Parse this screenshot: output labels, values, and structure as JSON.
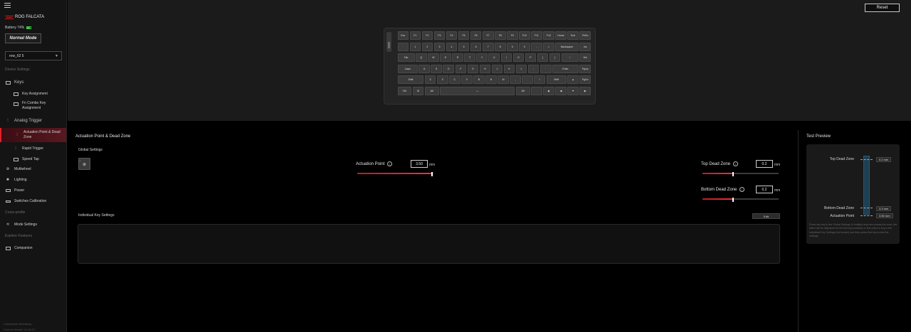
{
  "sidebar": {
    "menu_icon": "hamburger-icon",
    "brand": "ROG FALCATA",
    "battery_label": "Battery 74%",
    "battery_percent": 74,
    "mode_label": "Normal Mode",
    "profile": "row_62 5",
    "device_settings_label": "Device Settings",
    "keys_label": "Keys",
    "key_assignment": "Key Assignment",
    "fn_combo_line1": "Fn Combo Key",
    "fn_combo_line2": "Assignment",
    "analog_trigger_label": "Analog Trigger",
    "actuation_dead_zone_line1": "Actuation Point & Dead",
    "actuation_dead_zone_line2": "Zone",
    "rapid_trigger": "Rapid Trigger",
    "speed_tap": "Speed Tap",
    "multiwheel": "Multiwheel",
    "lighting": "Lighting",
    "power": "Power",
    "switches_calibration": "Switches Calibration",
    "cross_profile_label": "Cross-profile",
    "mode_settings": "Mode Settings",
    "explore_features_label": "Explore Features",
    "companion": "Companion",
    "footer_status": "Companion Activating...",
    "footer_version": "Control Version V1.00.07"
  },
  "toolbar": {
    "reset_label": "Reset"
  },
  "keyboard": {
    "rows": [
      [
        "Esc",
        "F1",
        "F2",
        "F3",
        "F4",
        "F5",
        "F6",
        "F7",
        "F8",
        "F9",
        "F10",
        "F11",
        "F12",
        "Home",
        "End",
        "PrtSc"
      ],
      [
        "`",
        "1",
        "2",
        "3",
        "4",
        "5",
        "6",
        "7",
        "8",
        "9",
        "0",
        "-",
        "=",
        "Backspace",
        "Ins"
      ],
      [
        "Tab",
        "Q",
        "W",
        "E",
        "R",
        "T",
        "Y",
        "U",
        "I",
        "O",
        "P",
        "[",
        "]",
        "\\",
        "Del"
      ],
      [
        "Caps",
        "A",
        "S",
        "D",
        "F",
        "G",
        "H",
        "J",
        "K",
        "L",
        ";",
        "'",
        "Enter",
        "PgUp"
      ],
      [
        "Shift",
        "Z",
        "X",
        "C",
        "V",
        "B",
        "N",
        "M",
        ",",
        ".",
        "/",
        "Shift",
        "▲",
        "PgDn"
      ],
      [
        "Ctrl",
        "⊞",
        "Alt",
        "—",
        "Alt",
        "",
        "◆",
        "◀",
        "▼",
        "▶"
      ]
    ]
  },
  "main": {
    "title": "Actuation Point & Dead Zone",
    "global_settings_label": "Global Settings",
    "actuation_point_label": "Actuation Point",
    "actuation_point_value": "3.50",
    "actuation_point_fraction": 0.98,
    "unit_mm": "mm",
    "top_dead_zone_label": "Top Dead Zone",
    "top_dead_zone_value": "0.2",
    "top_dead_zone_fraction": 0.4,
    "bottom_dead_zone_label": "Bottom Dead Zone",
    "bottom_dead_zone_value": "0.2",
    "bottom_dead_zone_fraction": 0.4,
    "individual_key_settings_label": "Individual Key Settings",
    "edit_label": "Edit"
  },
  "preview": {
    "title": "Test Preview",
    "top_dead_zone_label": "Top Dead Zone",
    "top_dead_zone_tag": "0.2 mm",
    "bottom_dead_zone_label": "Bottom Dead Zone",
    "bottom_dead_zone_tag": "3.3 mm",
    "actuation_point_label": "Actuation Point",
    "actuation_point_tag": "3.50 mm",
    "note": "Press any key in the Global Settings (if multiple keys are pressed at once, the effect will be displayed for the first key pressed) or first select a key in the Individual Key Settings (red border) and then press that key to test the settings."
  },
  "colors": {
    "accent": "#e0202a",
    "sidebar_bg": "#141414",
    "panel_bg": "#1b1b1b"
  }
}
